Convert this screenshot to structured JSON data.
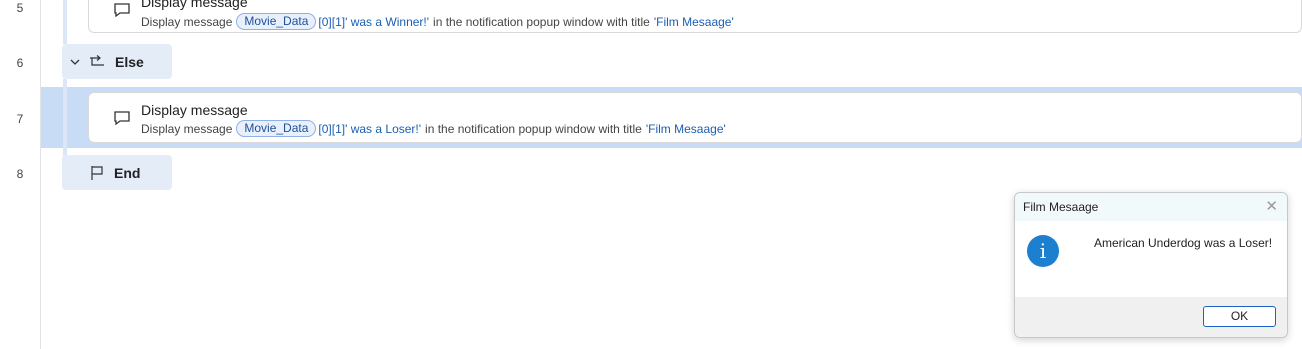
{
  "line_numbers": [
    "5",
    "6",
    "7",
    "8"
  ],
  "steps": [
    {
      "title": "Display message",
      "prefix": "Display message",
      "variable": "Movie_Data",
      "suffix_blue": "[0][1]' was a Winner!'",
      "middle": "in the notification popup window with title",
      "title_value": "'Film Mesaage'"
    },
    {
      "label": "Else"
    },
    {
      "title": "Display message",
      "prefix": "Display message",
      "variable": "Movie_Data",
      "suffix_blue": "[0][1]' was a Loser!'",
      "middle": "in the notification popup window with title",
      "title_value": "'Film Mesaage'"
    },
    {
      "label": "End"
    }
  ],
  "dialog": {
    "title": "Film Mesaage",
    "message": "American Underdog was a Loser!",
    "ok_label": "OK",
    "close_glyph": "✕",
    "info_glyph": "i"
  },
  "colors": {
    "selection": "#c9dcf5",
    "accent": "#1a5fb4"
  }
}
